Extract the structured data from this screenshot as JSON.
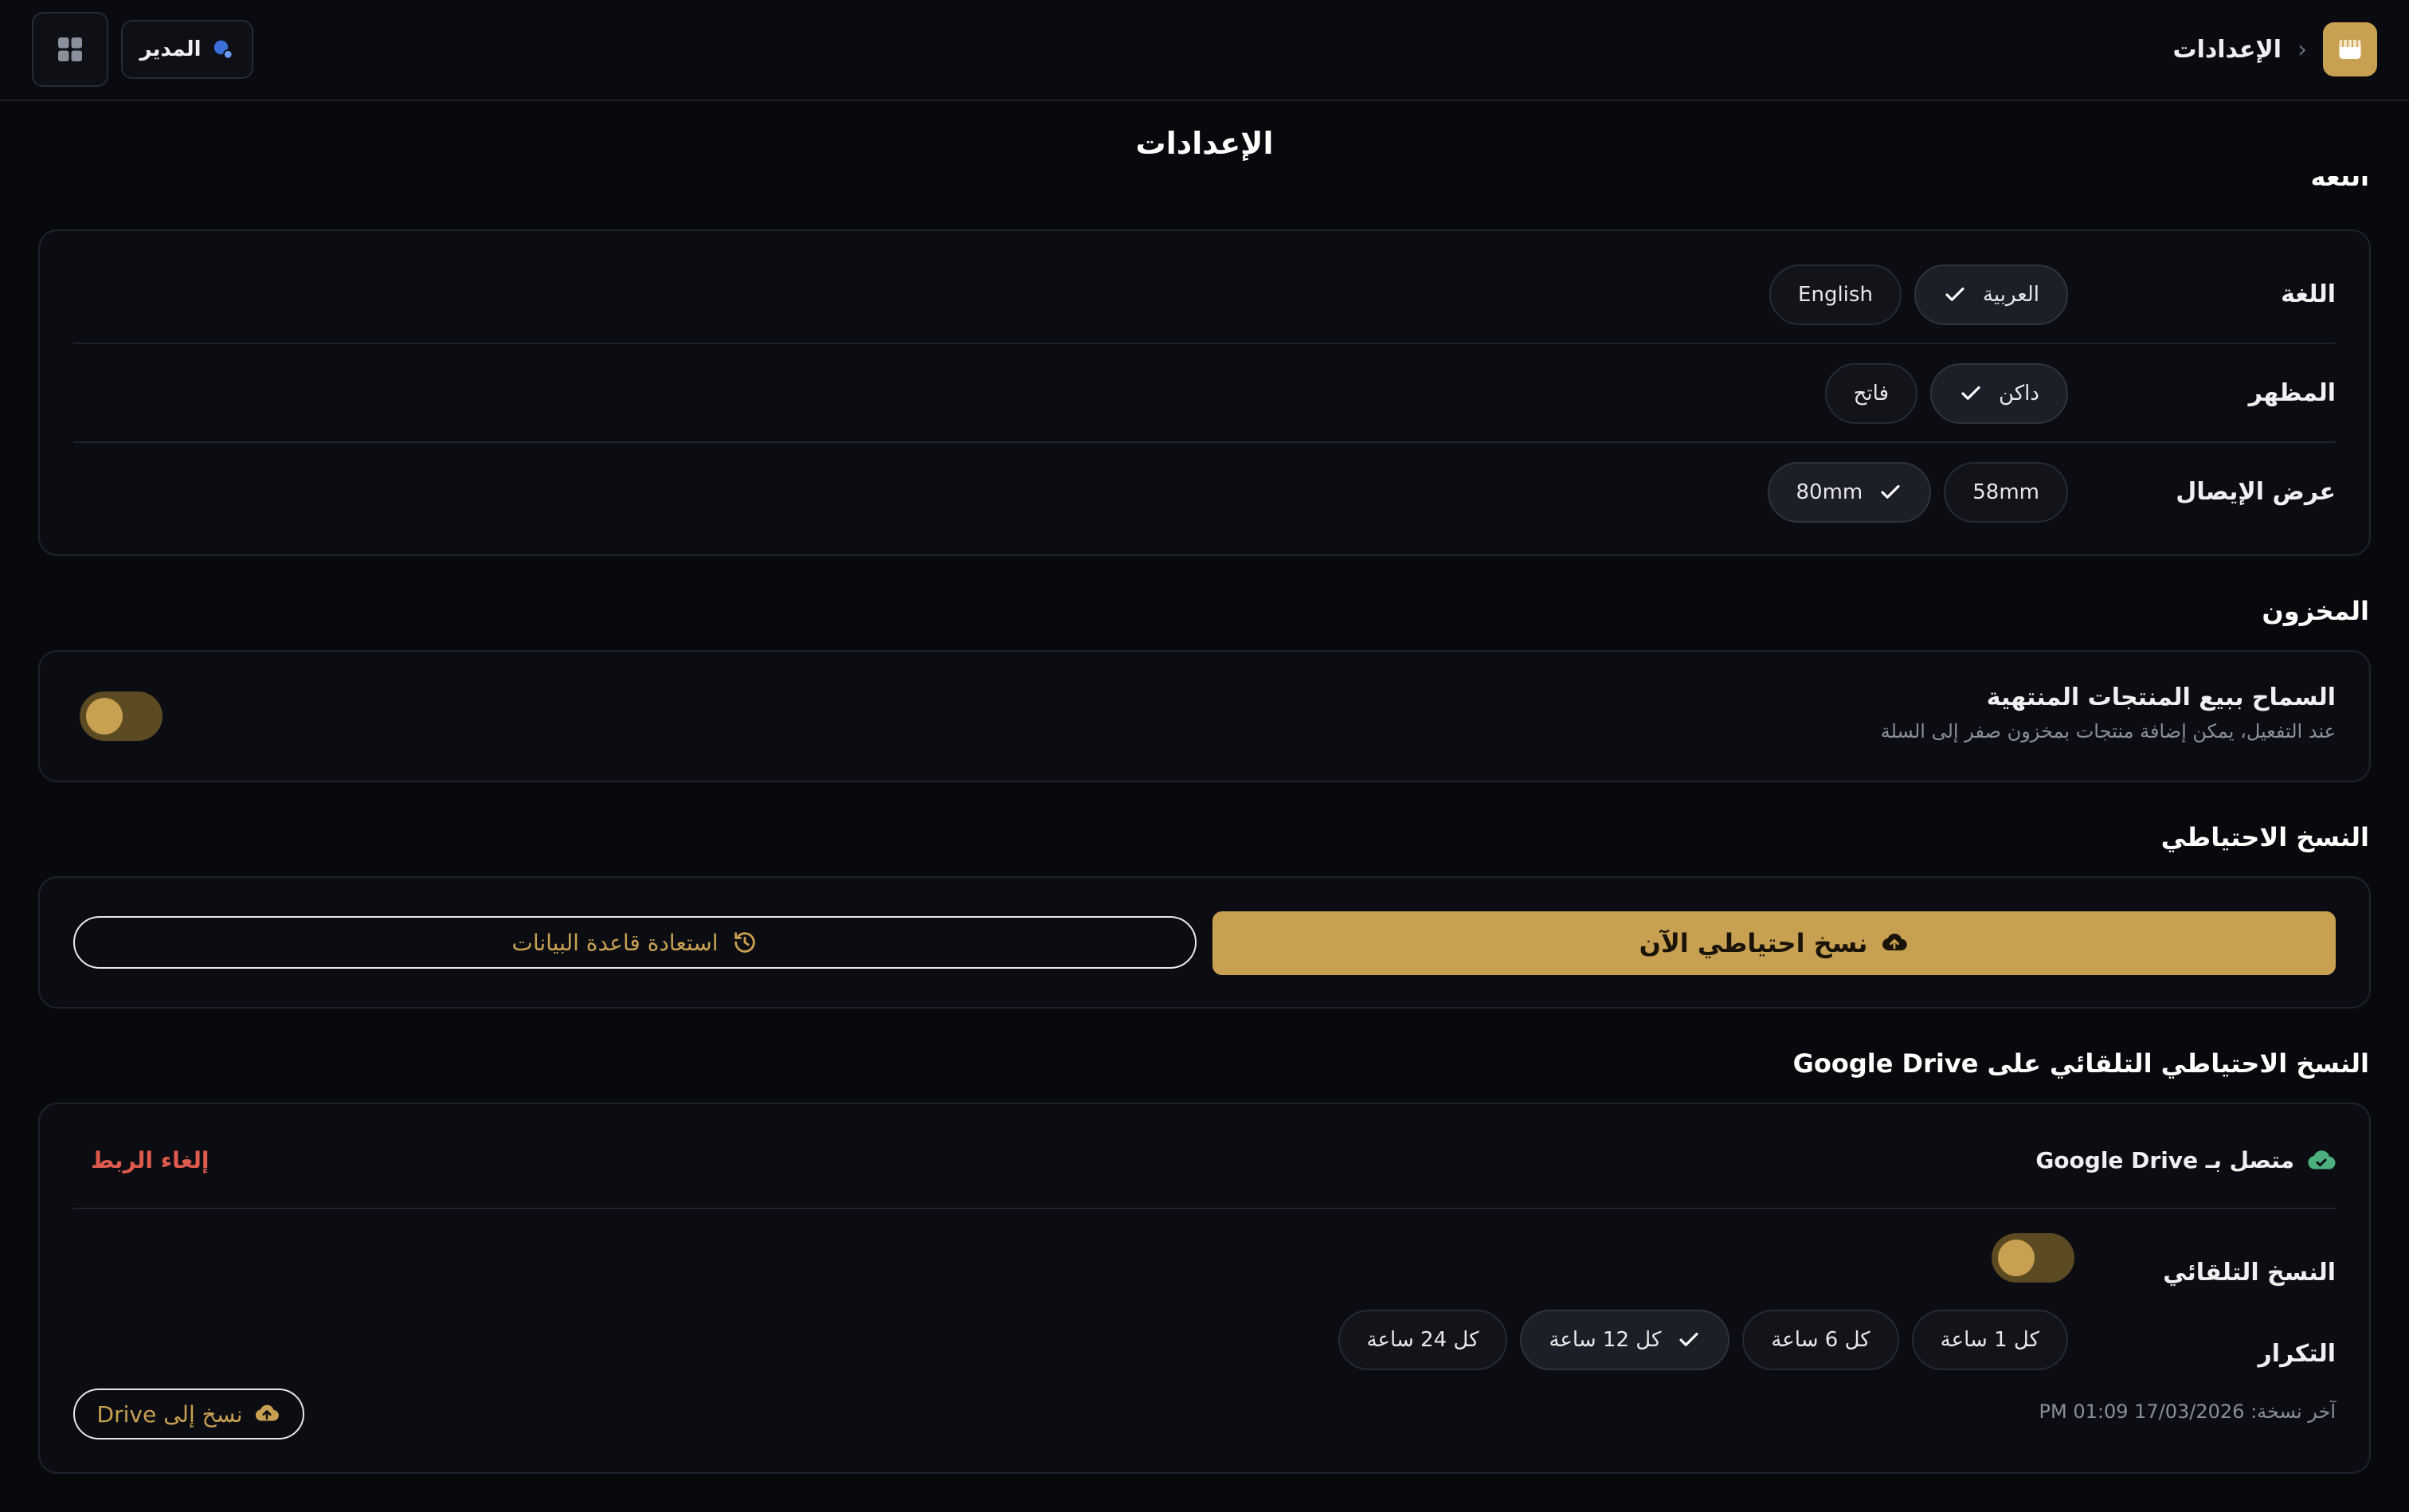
{
  "header": {
    "breadcrumb_title": "الإعدادات",
    "user_label": "المدير"
  },
  "page": {
    "title": "الإعدادات",
    "clipped_heading": "اللغة"
  },
  "general": {
    "language": {
      "label": "اللغة",
      "options": [
        "العربية",
        "English"
      ],
      "selected": "العربية"
    },
    "appearance": {
      "label": "المظهر",
      "options": [
        "داكن",
        "فاتح"
      ],
      "selected": "داكن"
    },
    "receipt": {
      "label": "عرض الإيصال",
      "options": [
        "58mm",
        "80mm"
      ],
      "selected": "80mm"
    }
  },
  "inventory": {
    "heading": "المخزون",
    "title": "السماح ببيع المنتجات المنتهية",
    "description": "عند التفعيل، يمكن إضافة منتجات بمخزون صفر إلى السلة",
    "toggle_on": false
  },
  "backup": {
    "heading": "النسخ الاحتياطي",
    "backup_now": "نسخ احتياطي الآن",
    "restore": "استعادة قاعدة البيانات"
  },
  "drive": {
    "heading": "النسخ الاحتياطي التلقائي على Google Drive",
    "status": "متصل بـ Google Drive",
    "unlink": "إلغاء الربط",
    "auto_backup": {
      "label": "النسخ التلقائي",
      "toggle_on": false
    },
    "frequency": {
      "label": "التكرار",
      "options": [
        "كل 1 ساعة",
        "كل 6 ساعة",
        "كل 12 ساعة",
        "كل 24 ساعة"
      ],
      "selected": "كل 12 ساعة"
    },
    "last_backup": "آخر نسخة: 17/03/2026 01:09 PM",
    "backup_to_drive": "نسخ إلى Drive"
  },
  "colors": {
    "accent": "#c8a052",
    "background": "#08090d",
    "card": "#0c0d12",
    "danger": "#e05a4e",
    "success": "#4caf7d"
  }
}
